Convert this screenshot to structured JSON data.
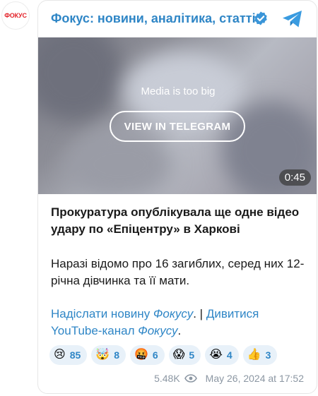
{
  "avatar": {
    "text": "ФОКУС"
  },
  "header": {
    "title": "Фокус: новини, аналітика, статті",
    "verified_icon": "verified-badge-icon",
    "telegram_icon": "telegram-icon"
  },
  "media": {
    "notice": "Media is too big",
    "button_label": "VIEW IN TELEGRAM",
    "duration": "0:45"
  },
  "post": {
    "title": "Прокуратура опублікувала ще одне відео удару по «Епіцентру» в Харкові",
    "body": "Наразі відомо про 16 загиблих, серед них 12-річна дівчинка та її мати.",
    "links": {
      "send_prefix": "Надіслати новину ",
      "send_it": "Фокусу",
      "separator": ". | ",
      "watch_prefix": "Дивитися YouTube-канал ",
      "watch_it": "Фокусу",
      "period": "."
    }
  },
  "reactions": [
    {
      "emoji": "😢",
      "count": "85"
    },
    {
      "emoji": "🤯",
      "count": "8"
    },
    {
      "emoji": "🤬",
      "count": "6"
    },
    {
      "emoji": "😱",
      "count": "5"
    },
    {
      "emoji": "😭",
      "count": "4"
    },
    {
      "emoji": "👍",
      "count": "3"
    }
  ],
  "meta": {
    "views": "5.48K",
    "date": "May 26, 2024 at 17:52"
  },
  "colors": {
    "accent": "#2f86c6",
    "brand_red": "#e32229",
    "reaction_bg": "#e8f1f9"
  }
}
